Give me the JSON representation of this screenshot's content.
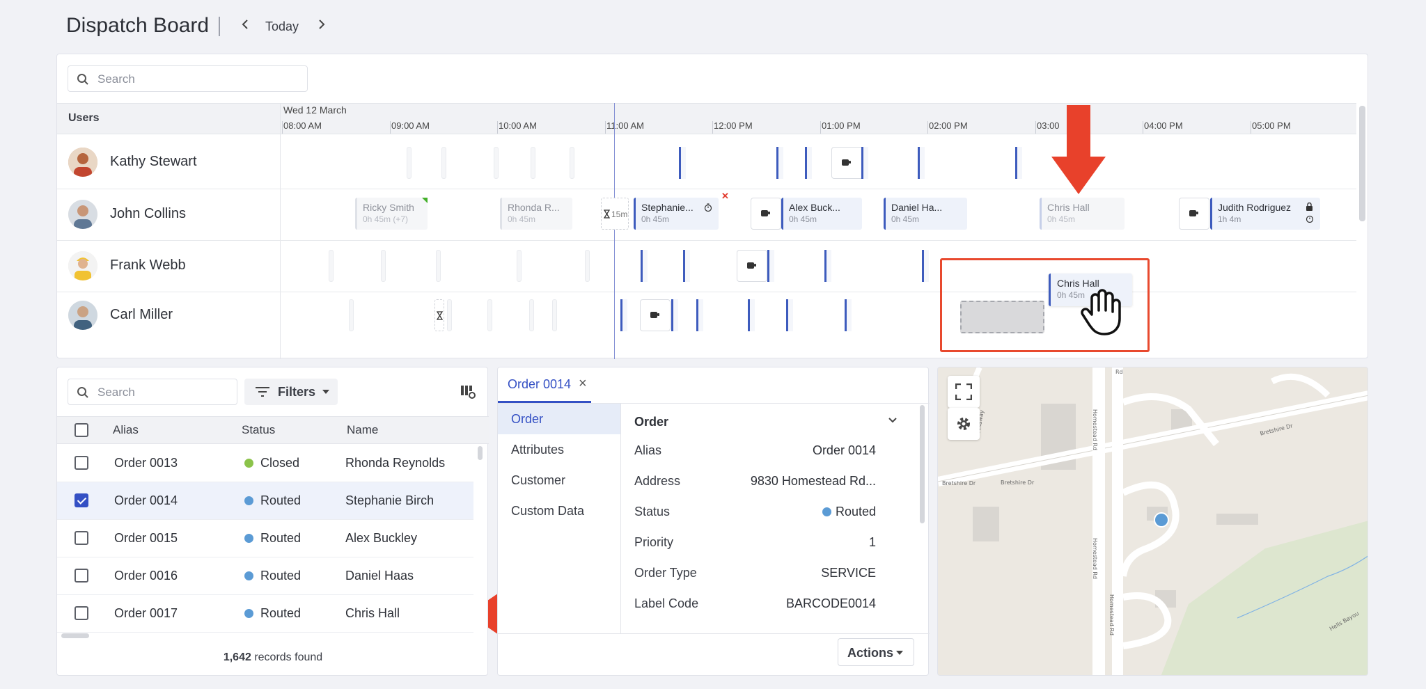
{
  "header": {
    "title": "Dispatch Board",
    "today_label": "Today",
    "prev_icon": "chevron-left-icon",
    "next_icon": "chevron-right-icon"
  },
  "scheduler": {
    "search_placeholder": "Search",
    "users_column_label": "Users",
    "date_label": "Wed 12 March",
    "time_labels": [
      "08:00 AM",
      "09:00 AM",
      "10:00 AM",
      "11:00 AM",
      "12:00 PM",
      "01:00 PM",
      "02:00 PM",
      "03:00",
      "04:00 PM",
      "05:00 PM"
    ],
    "users": [
      {
        "name": "Kathy Stewart"
      },
      {
        "name": "John Collins"
      },
      {
        "name": "Frank Webb"
      },
      {
        "name": "Carl Miller"
      }
    ],
    "events": [
      {
        "title": "Ricky Smith",
        "sub": "0h 45m (+7)"
      },
      {
        "title": "Rhonda R...",
        "sub": "0h 45m"
      },
      {
        "title": "Stephanie...",
        "sub": "0h 45m"
      },
      {
        "title": "Alex Buck...",
        "sub": "0h 45m"
      },
      {
        "title": "Daniel Ha...",
        "sub": "0h 45m"
      },
      {
        "title": "Chris Hall",
        "sub": "0h 45m"
      },
      {
        "title": "Judith Rodriguez",
        "sub": "1h 4m"
      }
    ],
    "gap_label": "15m",
    "drag_card": {
      "title": "Chris Hall",
      "sub": "0h 45m"
    }
  },
  "orders_list": {
    "search_placeholder": "Search",
    "filters_label": "Filters",
    "columns": {
      "alias": "Alias",
      "status": "Status",
      "name": "Name"
    },
    "rows": [
      {
        "alias": "Order 0013",
        "status": "Closed",
        "status_color": "#8bc34a",
        "name": "Rhonda Reynolds",
        "checked": false
      },
      {
        "alias": "Order 0014",
        "status": "Routed",
        "status_color": "#5b9bd5",
        "name": "Stephanie Birch",
        "checked": true
      },
      {
        "alias": "Order 0015",
        "status": "Routed",
        "status_color": "#5b9bd5",
        "name": "Alex Buckley",
        "checked": false
      },
      {
        "alias": "Order 0016",
        "status": "Routed",
        "status_color": "#5b9bd5",
        "name": "Daniel Haas",
        "checked": false
      },
      {
        "alias": "Order 0017",
        "status": "Routed",
        "status_color": "#5b9bd5",
        "name": "Chris Hall",
        "checked": false
      }
    ],
    "records_count": "1,642",
    "records_suffix": "records found"
  },
  "order_detail": {
    "tab_label": "Order 0014",
    "sidebar": [
      "Order",
      "Attributes",
      "Customer",
      "Custom Data"
    ],
    "section_title": "Order",
    "fields": [
      {
        "label": "Alias",
        "value": "Order 0014"
      },
      {
        "label": "Address",
        "value": "9830 Homestead Rd..."
      },
      {
        "label": "Status",
        "value": "Routed"
      },
      {
        "label": "Priority",
        "value": "1"
      },
      {
        "label": "Order Type",
        "value": "SERVICE"
      },
      {
        "label": "Label Code",
        "value": "BARCODE0014"
      }
    ],
    "actions_label": "Actions"
  },
  "map": {
    "road_labels": [
      "Bretshire Dr",
      "Bretshire Dr",
      "Bretshire Dr",
      "Homestead Rd",
      "Homestead Rd",
      "Homestead Rd",
      "Rockaway",
      "Rd",
      "Hells Bayou"
    ],
    "fullscreen_icon": "fullscreen-icon",
    "settings_icon": "gear-icon"
  },
  "colors": {
    "accent": "#3450c4",
    "event_border": "#3d5bbd",
    "annotation_red": "#e8492e",
    "routed": "#5b9bd5",
    "closed": "#8bc34a"
  }
}
